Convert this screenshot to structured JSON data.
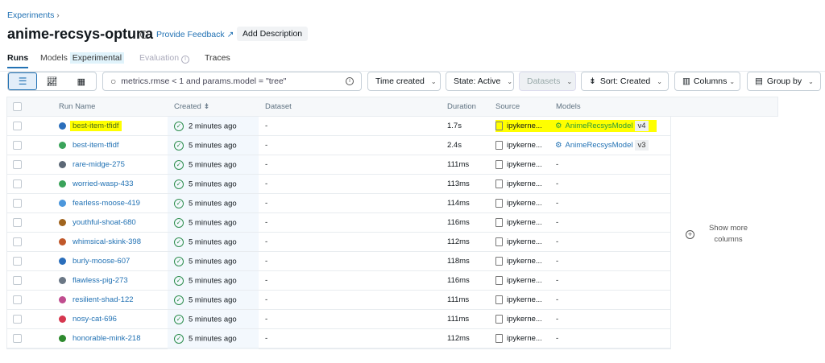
{
  "breadcrumb": {
    "label": "Experiments",
    "sep": "›"
  },
  "header": {
    "title": "anime-recsys-optuna",
    "feedback": "Provide Feedback",
    "add_description": "Add Description"
  },
  "tabs": [
    {
      "label": "Runs"
    },
    {
      "label": "Models"
    },
    {
      "label": "Evaluation"
    },
    {
      "label": "Traces"
    }
  ],
  "tab_badge": "Experimental",
  "toolbar": {
    "search_value": "metrics.rmse < 1 and params.model = \"tree\"",
    "time": "Time created",
    "state": "State: Active",
    "datasets": "Datasets",
    "sort": "Sort: Created",
    "columns": "Columns",
    "group": "Group by"
  },
  "table": {
    "headers": [
      "Run Name",
      "Created",
      "Dataset",
      "Duration",
      "Source",
      "Models"
    ],
    "rows": [
      {
        "name": "best-item-tfidf",
        "color": "#2a6ebb",
        "created": "2 minutes ago",
        "dataset": "-",
        "duration": "1.7s",
        "source": "ipykerne...",
        "model": "AnimeRecsysModel",
        "version": "v4",
        "highlight": true
      },
      {
        "name": "best-item-tfidf",
        "color": "#3aa35a",
        "created": "5 minutes ago",
        "dataset": "-",
        "duration": "2.4s",
        "source": "ipykerne...",
        "model": "AnimeRecsysModel",
        "version": "v3"
      },
      {
        "name": "rare-midge-275",
        "color": "#5c6876",
        "created": "5 minutes ago",
        "dataset": "-",
        "duration": "111ms",
        "source": "ipykerne...",
        "model": "-"
      },
      {
        "name": "worried-wasp-433",
        "color": "#3aa35a",
        "created": "5 minutes ago",
        "dataset": "-",
        "duration": "113ms",
        "source": "ipykerne...",
        "model": "-"
      },
      {
        "name": "fearless-moose-419",
        "color": "#4c97dc",
        "created": "5 minutes ago",
        "dataset": "-",
        "duration": "114ms",
        "source": "ipykerne...",
        "model": "-"
      },
      {
        "name": "youthful-shoat-680",
        "color": "#a0641e",
        "created": "5 minutes ago",
        "dataset": "-",
        "duration": "116ms",
        "source": "ipykerne...",
        "model": "-"
      },
      {
        "name": "whimsical-skink-398",
        "color": "#c0582a",
        "created": "5 minutes ago",
        "dataset": "-",
        "duration": "112ms",
        "source": "ipykerne...",
        "model": "-"
      },
      {
        "name": "burly-moose-607",
        "color": "#2a6ebb",
        "created": "5 minutes ago",
        "dataset": "-",
        "duration": "118ms",
        "source": "ipykerne...",
        "model": "-"
      },
      {
        "name": "flawless-pig-273",
        "color": "#6b7785",
        "created": "5 minutes ago",
        "dataset": "-",
        "duration": "116ms",
        "source": "ipykerne...",
        "model": "-"
      },
      {
        "name": "resilient-shad-122",
        "color": "#c04d8f",
        "created": "5 minutes ago",
        "dataset": "-",
        "duration": "111ms",
        "source": "ipykerne...",
        "model": "-"
      },
      {
        "name": "nosy-cat-696",
        "color": "#d6374f",
        "created": "5 minutes ago",
        "dataset": "-",
        "duration": "111ms",
        "source": "ipykerne...",
        "model": "-"
      },
      {
        "name": "honorable-mink-218",
        "color": "#2e8a2e",
        "created": "5 minutes ago",
        "dataset": "-",
        "duration": "112ms",
        "source": "ipykerne...",
        "model": "-"
      }
    ]
  },
  "show_more": "Show more columns"
}
